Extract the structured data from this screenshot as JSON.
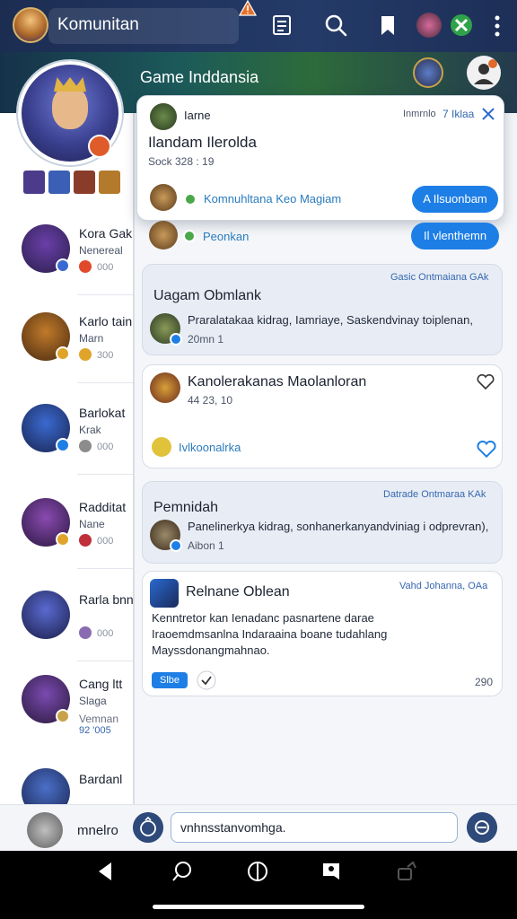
{
  "app_bar": {
    "title": "Komunitan",
    "icons": [
      "app-avatar",
      "warning-icon",
      "list-icon",
      "search-icon",
      "bookmark-icon",
      "friend-avatar",
      "xbox-icon",
      "more-vertical-icon"
    ]
  },
  "banner": {
    "title": "Game Inddansia"
  },
  "profile": {
    "avatar": "hero-avatar",
    "badge_color": "#e05b2a",
    "thumb_colors": [
      "#4b3b8a",
      "#3b5fb5",
      "#8a3c2a",
      "#b27a2a"
    ]
  },
  "friends": [
    {
      "name": "Kora Gak",
      "sub": "Nenereal",
      "stat": "000",
      "coin_color": "#e04a2a",
      "avatar_colors": [
        "#6a3fa8",
        "#2a1f4c"
      ]
    },
    {
      "name": "Karlo tain",
      "sub": "Marn",
      "stat": "300",
      "coin_color": "#e0a42a",
      "avatar_colors": [
        "#c07a2a",
        "#4a2a10"
      ]
    },
    {
      "name": "Barlokat",
      "sub": "Krak",
      "stat": "000",
      "coin_color": "#8c8c8c",
      "avatar_colors": [
        "#3a6ad0",
        "#1a2450"
      ]
    },
    {
      "name": "Radditat",
      "sub": "Nane",
      "stat": "000",
      "coin_color": "#c0303a",
      "avatar_colors": [
        "#8a4ab0",
        "#2a1840"
      ]
    },
    {
      "name": "Rarla bnn",
      "sub": "",
      "stat": "000",
      "coin_color": "#8a6ab0",
      "avatar_colors": [
        "#5a6ad0",
        "#1a1e48"
      ]
    },
    {
      "name": "Cang ltt",
      "sub": "Slaga",
      "stat": "Vemnan",
      "count": "92 '005",
      "coin_color": "#c8a24a",
      "avatar_colors": [
        "#7a4ab0",
        "#2a1a3c"
      ]
    },
    {
      "name": "Bardanl",
      "sub": "",
      "stat": "",
      "coin_color": "#e0a42a",
      "avatar_colors": [
        "#4a70c8",
        "#1a2450"
      ]
    }
  ],
  "popup_card": {
    "label": "Iarne",
    "meta": "Inmrnlo",
    "meta_link": "7 Iklaa",
    "title": "Ilandam Ilerolda",
    "subtitle": "Sock 328 : 19",
    "community_name": "Komnuhltana Keo Magiam",
    "button": "A Ilsuonbam"
  },
  "row_recommend": {
    "label": "Peonkan",
    "button": "Il vlenthemn"
  },
  "posts": [
    {
      "meta": "Gasic Ontmaiana  GAk",
      "title": "Uagam Obmlank",
      "body": "Praralatakaa kidrag, Iamriaye, Saskendvinay toiplenan,",
      "time": "20mn 1"
    },
    {
      "title": "Kanolerakanas Maolanloran",
      "time": "44 23, 10",
      "link": "Ivlkoonalrka"
    },
    {
      "meta": "Datrade Ontmaraa  KAk",
      "title": "Pemnidah",
      "body": "Panelinerkya kidrag, sonhanerkanyandviniag i odprevran),",
      "time": "Aibon 1"
    },
    {
      "meta": "Vahd Johanna, OAa",
      "title": "Relnane Oblean",
      "body_lines": [
        "Kenntretor kan Ienadanc pasnartene darae",
        "Iraoemdmsanlna Indaraaina boane tudahlang",
        "Mayssdonangmahnao."
      ],
      "tag": "Slbe",
      "count": "290"
    }
  ],
  "compose": {
    "user_name": "mnelro",
    "placeholder": "",
    "value": "vnhnsstanvomhga."
  },
  "colors": {
    "primary": "#1d7ee6",
    "app_bar": "#1c2d52",
    "card_tint": "#e8edf5",
    "link": "#2a7bbd"
  }
}
